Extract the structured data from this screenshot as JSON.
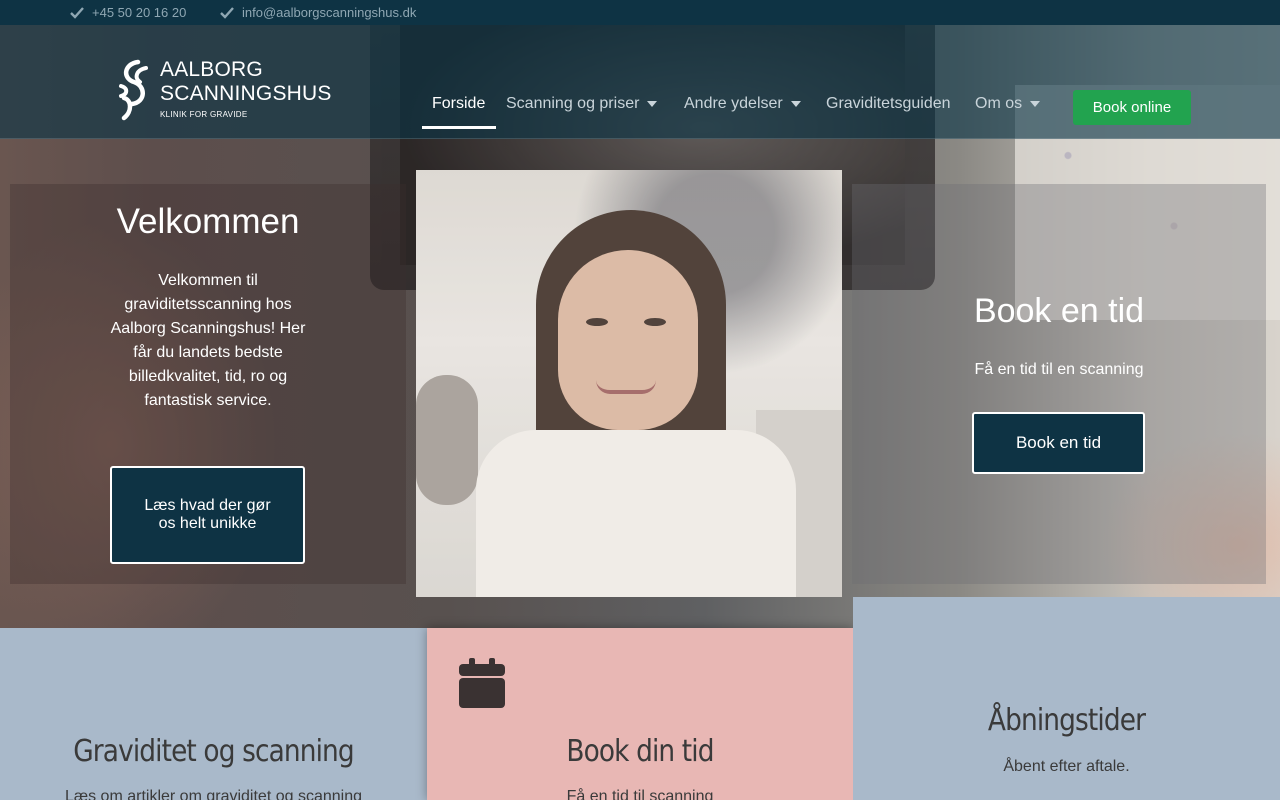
{
  "topbar": {
    "phone": "+45 50 20 16 20",
    "email": "info@aalborgscanningshus.dk"
  },
  "logo": {
    "line1": "AALBORG",
    "line2": "SCANNINGSHUS",
    "tagline": "KLINIK FOR GRAVIDE"
  },
  "nav": {
    "items": [
      {
        "label": "Forside",
        "active": true
      },
      {
        "label": "Scanning og priser",
        "dropdown": true
      },
      {
        "label": "Andre ydelser",
        "dropdown": true
      },
      {
        "label": "Graviditetsguiden"
      },
      {
        "label": "Om os",
        "dropdown": true
      }
    ],
    "cta": "Book online"
  },
  "hero": {
    "welcome_title": "Velkommen",
    "welcome_text": "Velkommen til graviditetsscanning hos Aalborg Scanningshus! Her får du landets bedste billedkvalitet, tid, ro og fantastisk service.",
    "welcome_button": "Læs hvad der gør os helt unikke",
    "book_title": "Book en tid",
    "book_subtitle": "Få en tid til en scanning",
    "book_button": "Book en tid"
  },
  "cards": {
    "left_title": "Graviditet og scanning",
    "left_text": "Læs om artikler om graviditet og scanning",
    "mid_icon": "calendar-icon",
    "mid_title": "Book din tid",
    "mid_text": "Få en tid til scanning",
    "right_title": "Åbningstider",
    "right_text": "Åbent efter aftale."
  },
  "colors": {
    "navy": "#0e3344",
    "green": "#22a34f",
    "pink": "#e8b7b4",
    "blue_grey": "#a9b9ca"
  }
}
